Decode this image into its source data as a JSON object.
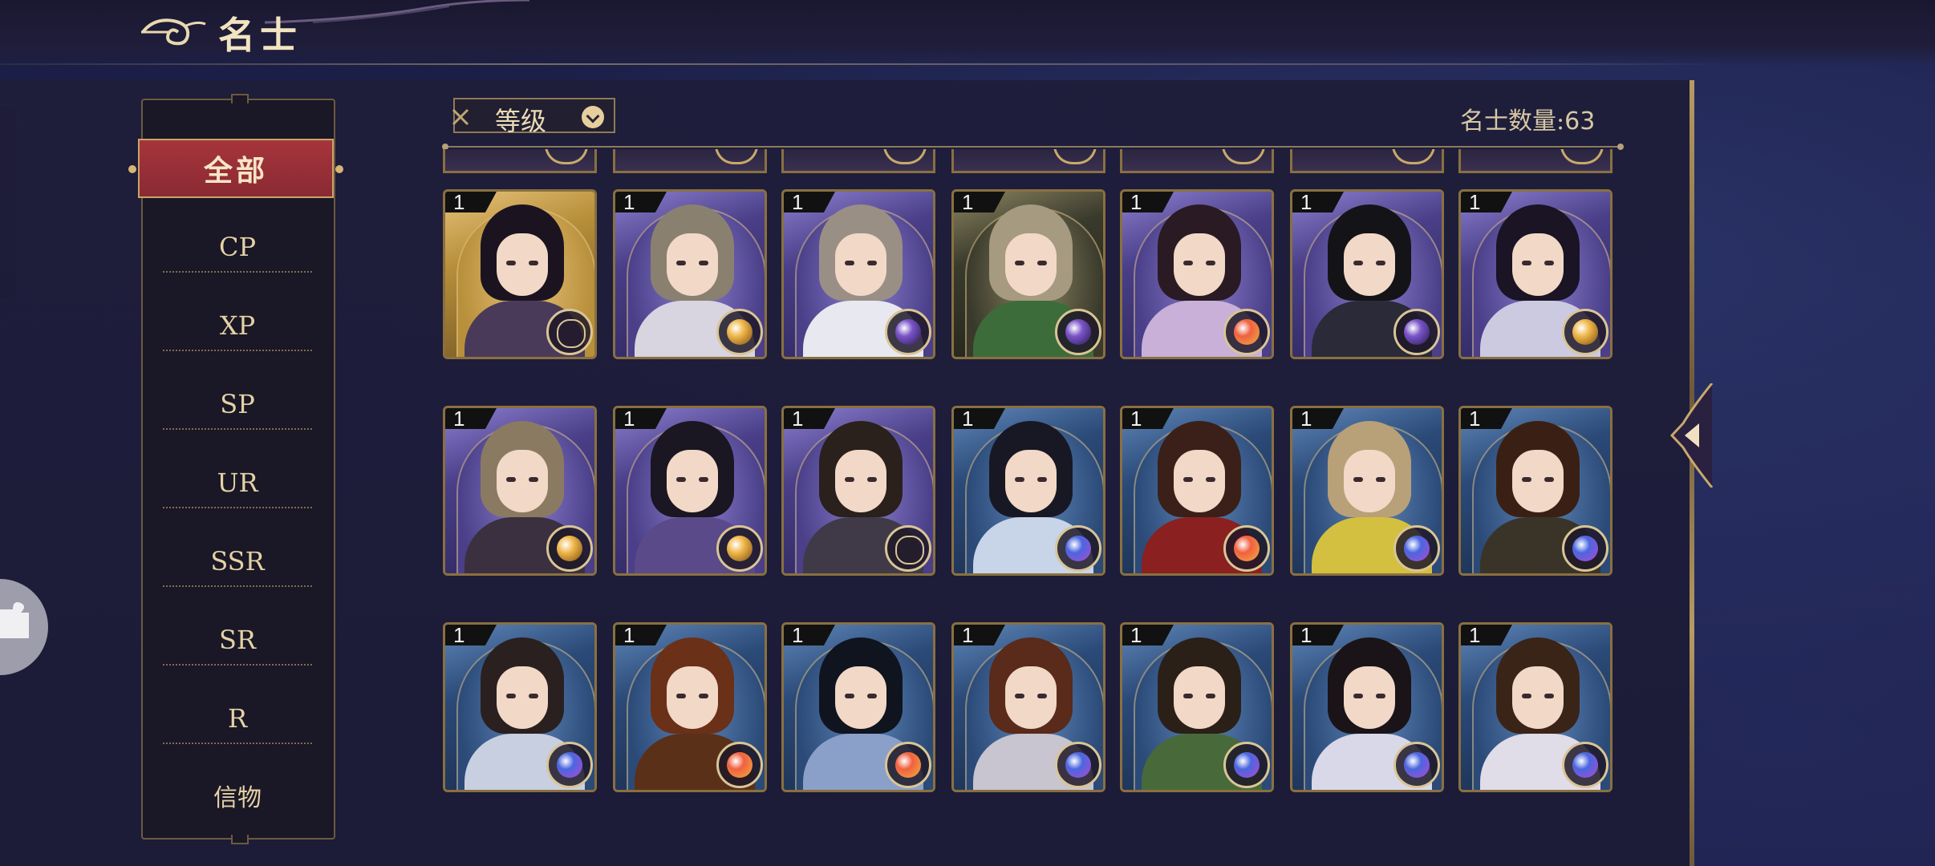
{
  "header": {
    "title": "名士"
  },
  "sidebar": {
    "active": "全部",
    "items": [
      "CP",
      "XP",
      "SP",
      "UR",
      "SSR",
      "SR",
      "R",
      "信物"
    ]
  },
  "toolbar": {
    "sort_label": "等级",
    "count_label": "名士数量:",
    "count_value": "63"
  },
  "rarity_colors": {
    "gold": "#e8a43a",
    "purple": "#7a55c8",
    "blue": "#4b6bd6",
    "red": "#d8503a",
    "dark": "#3a3628"
  },
  "cards": [
    {
      "level": "1",
      "theme": "gold",
      "orb": "compass",
      "hair": "#1b1420",
      "robe": "#4a3a5a"
    },
    {
      "level": "1",
      "theme": "purple",
      "orb": "gold",
      "hair": "#8a8070",
      "robe": "#d8d4e0"
    },
    {
      "level": "1",
      "theme": "purple",
      "orb": "purple",
      "hair": "#9a8f85",
      "robe": "#e8e8f0"
    },
    {
      "level": "1",
      "theme": "dark",
      "orb": "purple",
      "hair": "#a69a80",
      "robe": "#3c6c3a"
    },
    {
      "level": "1",
      "theme": "purple",
      "orb": "red",
      "hair": "#2a1a24",
      "robe": "#c8b0d8"
    },
    {
      "level": "1",
      "theme": "purple",
      "orb": "purple",
      "hair": "#141418",
      "robe": "#2a2a38"
    },
    {
      "level": "1",
      "theme": "purple",
      "orb": "gold",
      "hair": "#1a1424",
      "robe": "#cccae0"
    },
    {
      "level": "1",
      "theme": "purple",
      "orb": "gold",
      "hair": "#8a7a62",
      "robe": "#3a3040"
    },
    {
      "level": "1",
      "theme": "purple",
      "orb": "gold",
      "hair": "#1a1622",
      "robe": "#5a4a8a"
    },
    {
      "level": "1",
      "theme": "purple",
      "orb": "compass",
      "hair": "#2a201c",
      "robe": "#403a48"
    },
    {
      "level": "1",
      "theme": "blue",
      "orb": "blue",
      "hair": "#181824",
      "robe": "#c8d4e8"
    },
    {
      "level": "1",
      "theme": "blue",
      "orb": "red",
      "hair": "#3a2018",
      "robe": "#8a2020"
    },
    {
      "level": "1",
      "theme": "blue",
      "orb": "blue",
      "hair": "#b8a078",
      "robe": "#d4c040"
    },
    {
      "level": "1",
      "theme": "blue",
      "orb": "blue",
      "hair": "#3a2014",
      "robe": "#3a3428"
    },
    {
      "level": "1",
      "theme": "blue",
      "orb": "blue",
      "hair": "#2a2020",
      "robe": "#c8cfe0"
    },
    {
      "level": "1",
      "theme": "blue",
      "orb": "red",
      "hair": "#6a3018",
      "robe": "#5a3018"
    },
    {
      "level": "1",
      "theme": "blue",
      "orb": "red",
      "hair": "#10141e",
      "robe": "#8aa0c8"
    },
    {
      "level": "1",
      "theme": "blue",
      "orb": "blue",
      "hair": "#5a2a1a",
      "robe": "#c8c4d0"
    },
    {
      "level": "1",
      "theme": "blue",
      "orb": "blue",
      "hair": "#2a2018",
      "robe": "#486a3a"
    },
    {
      "level": "1",
      "theme": "blue",
      "orb": "blue",
      "hair": "#1a1418",
      "robe": "#d8d8e8"
    },
    {
      "level": "1",
      "theme": "blue",
      "orb": "blue",
      "hair": "#3a2418",
      "robe": "#e0dce8"
    }
  ]
}
